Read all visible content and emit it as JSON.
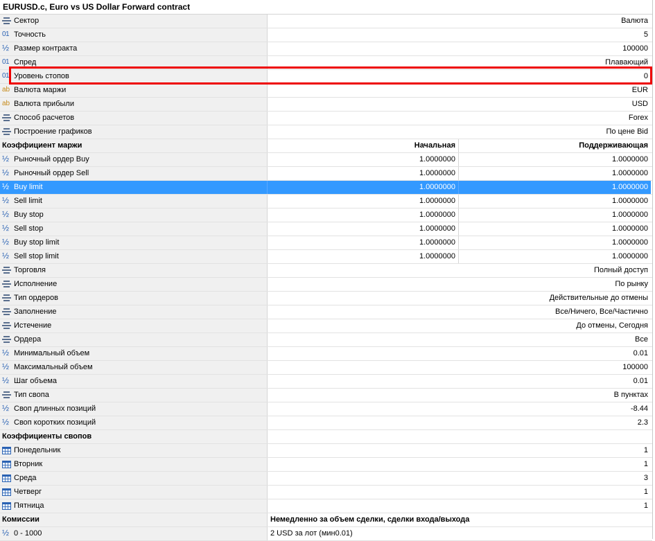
{
  "title": "EURUSD.c, Euro vs US Dollar Forward contract",
  "accent_color": "#3399ff",
  "highlight_color": "#ee0000",
  "specs": [
    {
      "icon": "list-icon",
      "label": "Сектор",
      "value": "Валюта"
    },
    {
      "icon": "number-icon",
      "label": "Точность",
      "value": "5"
    },
    {
      "icon": "fraction-icon",
      "label": "Размер контракта",
      "value": "100000"
    },
    {
      "icon": "number-icon",
      "label": "Спред",
      "value": "Плавающий"
    },
    {
      "icon": "number-icon",
      "label": "Уровень стопов",
      "value": "0"
    },
    {
      "icon": "text-icon",
      "label": "Валюта маржи",
      "value": "EUR"
    },
    {
      "icon": "text-icon",
      "label": "Валюта прибыли",
      "value": "USD"
    },
    {
      "icon": "list-icon",
      "label": "Способ расчетов",
      "value": "Forex"
    },
    {
      "icon": "list-icon",
      "label": "Построение графиков",
      "value": "По цене Bid"
    }
  ],
  "margin": {
    "header": "Коэффициент маржи",
    "col_initial": "Начальная",
    "col_maintenance": "Поддерживающая",
    "rows": [
      {
        "label": "Рыночный ордер Buy",
        "initial": "1.0000000",
        "maintenance": "1.0000000"
      },
      {
        "label": "Рыночный ордер Sell",
        "initial": "1.0000000",
        "maintenance": "1.0000000"
      },
      {
        "label": "Buy limit",
        "initial": "1.0000000",
        "maintenance": "1.0000000"
      },
      {
        "label": "Sell limit",
        "initial": "1.0000000",
        "maintenance": "1.0000000"
      },
      {
        "label": "Buy stop",
        "initial": "1.0000000",
        "maintenance": "1.0000000"
      },
      {
        "label": "Sell stop",
        "initial": "1.0000000",
        "maintenance": "1.0000000"
      },
      {
        "label": "Buy stop limit",
        "initial": "1.0000000",
        "maintenance": "1.0000000"
      },
      {
        "label": "Sell stop limit",
        "initial": "1.0000000",
        "maintenance": "1.0000000"
      }
    ]
  },
  "trading": [
    {
      "icon": "list-icon",
      "label": "Торговля",
      "value": "Полный доступ"
    },
    {
      "icon": "list-icon",
      "label": "Исполнение",
      "value": "По рынку"
    },
    {
      "icon": "list-icon",
      "label": "Тип ордеров",
      "value": "Действительные до отмены"
    },
    {
      "icon": "list-icon",
      "label": "Заполнение",
      "value": "Все/Ничего, Все/Частично"
    },
    {
      "icon": "list-icon",
      "label": "Истечение",
      "value": "До отмены, Сегодня"
    },
    {
      "icon": "list-icon",
      "label": "Ордера",
      "value": "Все"
    },
    {
      "icon": "fraction-icon",
      "label": "Минимальный объем",
      "value": "0.01"
    },
    {
      "icon": "fraction-icon",
      "label": "Максимальный объем",
      "value": "100000"
    },
    {
      "icon": "fraction-icon",
      "label": "Шаг объема",
      "value": "0.01"
    },
    {
      "icon": "list-icon",
      "label": "Тип свопа",
      "value": "В пунктах"
    },
    {
      "icon": "fraction-icon",
      "label": "Своп длинных позиций",
      "value": "-8.44"
    },
    {
      "icon": "fraction-icon",
      "label": "Своп коротких позиций",
      "value": "2.3"
    }
  ],
  "swap": {
    "header": "Коэффициенты свопов",
    "rows": [
      {
        "label": "Понедельник",
        "value": "1"
      },
      {
        "label": "Вторник",
        "value": "1"
      },
      {
        "label": "Среда",
        "value": "3"
      },
      {
        "label": "Четверг",
        "value": "1"
      },
      {
        "label": "Пятница",
        "value": "1"
      }
    ]
  },
  "commission": {
    "header": "Комиссии",
    "header_value": "Немедленно за объем сделки, сделки входа/выхода",
    "rows": [
      {
        "label": "0 - 1000",
        "value": "2 USD за лот (мин0.01)"
      }
    ]
  }
}
